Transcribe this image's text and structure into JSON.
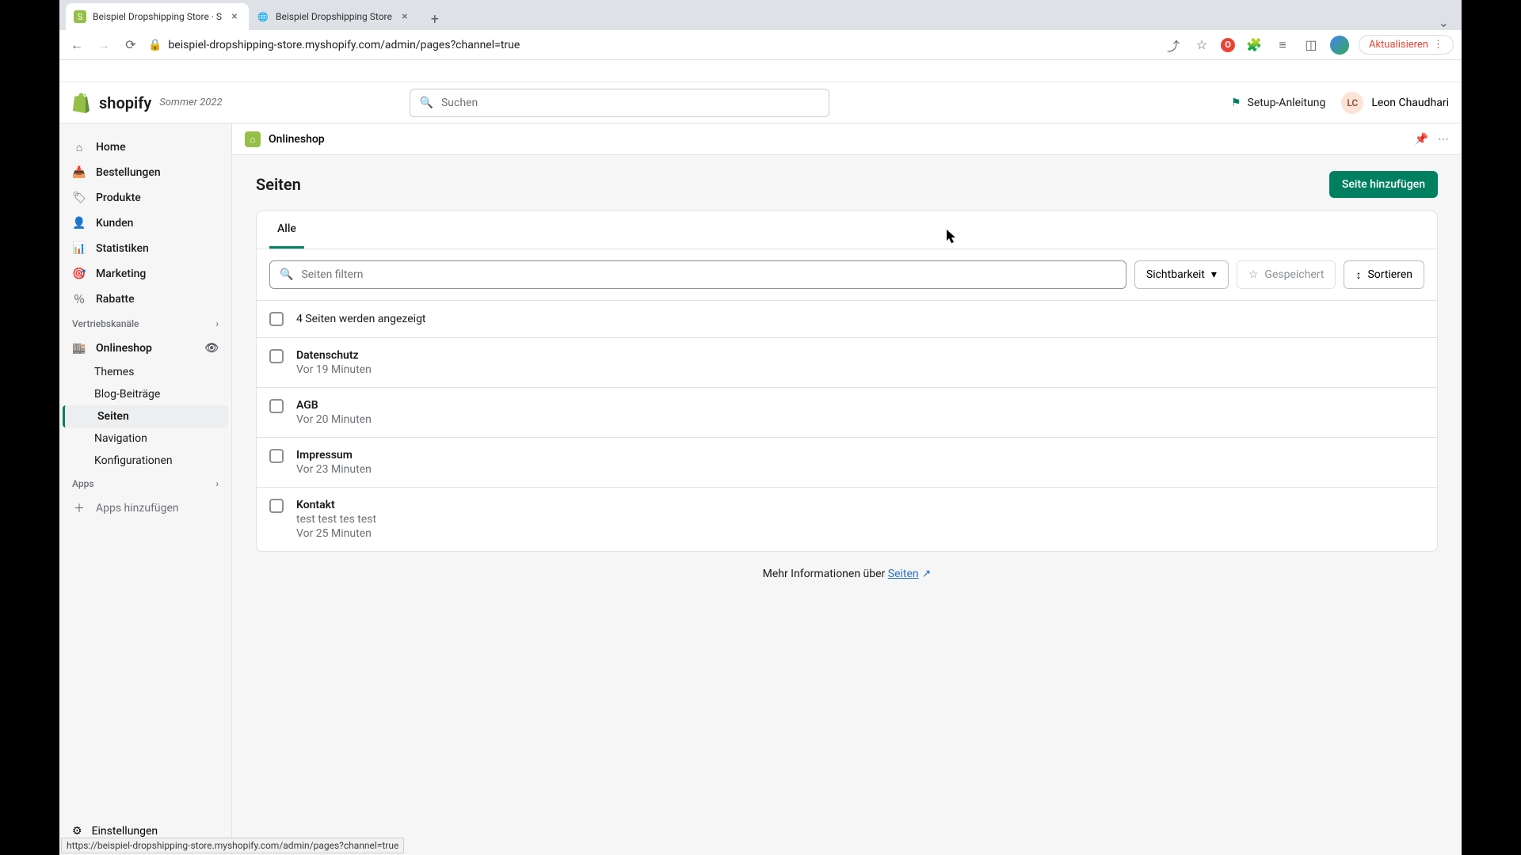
{
  "browser": {
    "tabs": [
      {
        "title": "Beispiel Dropshipping Store · S",
        "favicon_bg": "#95bf47"
      },
      {
        "title": "Beispiel Dropshipping Store",
        "favicon_bg": "#6d7175"
      }
    ],
    "url": "beispiel-dropshipping-store.myshopify.com/admin/pages?channel=true",
    "update_label": "Aktualisieren",
    "status_url": "https://beispiel-dropshipping-store.myshopify.com/admin/pages?channel=true"
  },
  "header": {
    "logo_text": "shopify",
    "badge": "Sommer 2022",
    "search_placeholder": "Suchen",
    "setup_guide": "Setup-Anleitung",
    "user_initials": "LC",
    "user_name": "Leon Chaudhari"
  },
  "sidebar": {
    "items": [
      {
        "label": "Home"
      },
      {
        "label": "Bestellungen"
      },
      {
        "label": "Produkte"
      },
      {
        "label": "Kunden"
      },
      {
        "label": "Statistiken"
      },
      {
        "label": "Marketing"
      },
      {
        "label": "Rabatte"
      }
    ],
    "section_channels": "Vertriebskanäle",
    "onlineshop": "Onlineshop",
    "sub": [
      {
        "label": "Themes"
      },
      {
        "label": "Blog-Beiträge"
      },
      {
        "label": "Seiten",
        "active": true
      },
      {
        "label": "Navigation"
      },
      {
        "label": "Konfigurationen"
      }
    ],
    "section_apps": "Apps",
    "apps_add": "Apps hinzufügen",
    "settings": "Einstellungen"
  },
  "context_bar": {
    "title": "Onlineshop"
  },
  "page": {
    "title": "Seiten",
    "add_button": "Seite hinzufügen",
    "tab_all": "Alle",
    "filter_placeholder": "Seiten filtern",
    "visibility": "Sichtbarkeit",
    "saved": "Gespeichert",
    "sort": "Sortieren",
    "count_label": "4 Seiten werden angezeigt",
    "rows": [
      {
        "title": "Datenschutz",
        "meta": "Vor 19 Minuten"
      },
      {
        "title": "AGB",
        "meta": "Vor 20 Minuten"
      },
      {
        "title": "Impressum",
        "meta": "Vor 23 Minuten"
      },
      {
        "title": "Kontakt",
        "excerpt": "test test tes test",
        "meta": "Vor 25 Minuten"
      }
    ],
    "more_info_prefix": "Mehr Informationen über ",
    "more_info_link": "Seiten"
  }
}
